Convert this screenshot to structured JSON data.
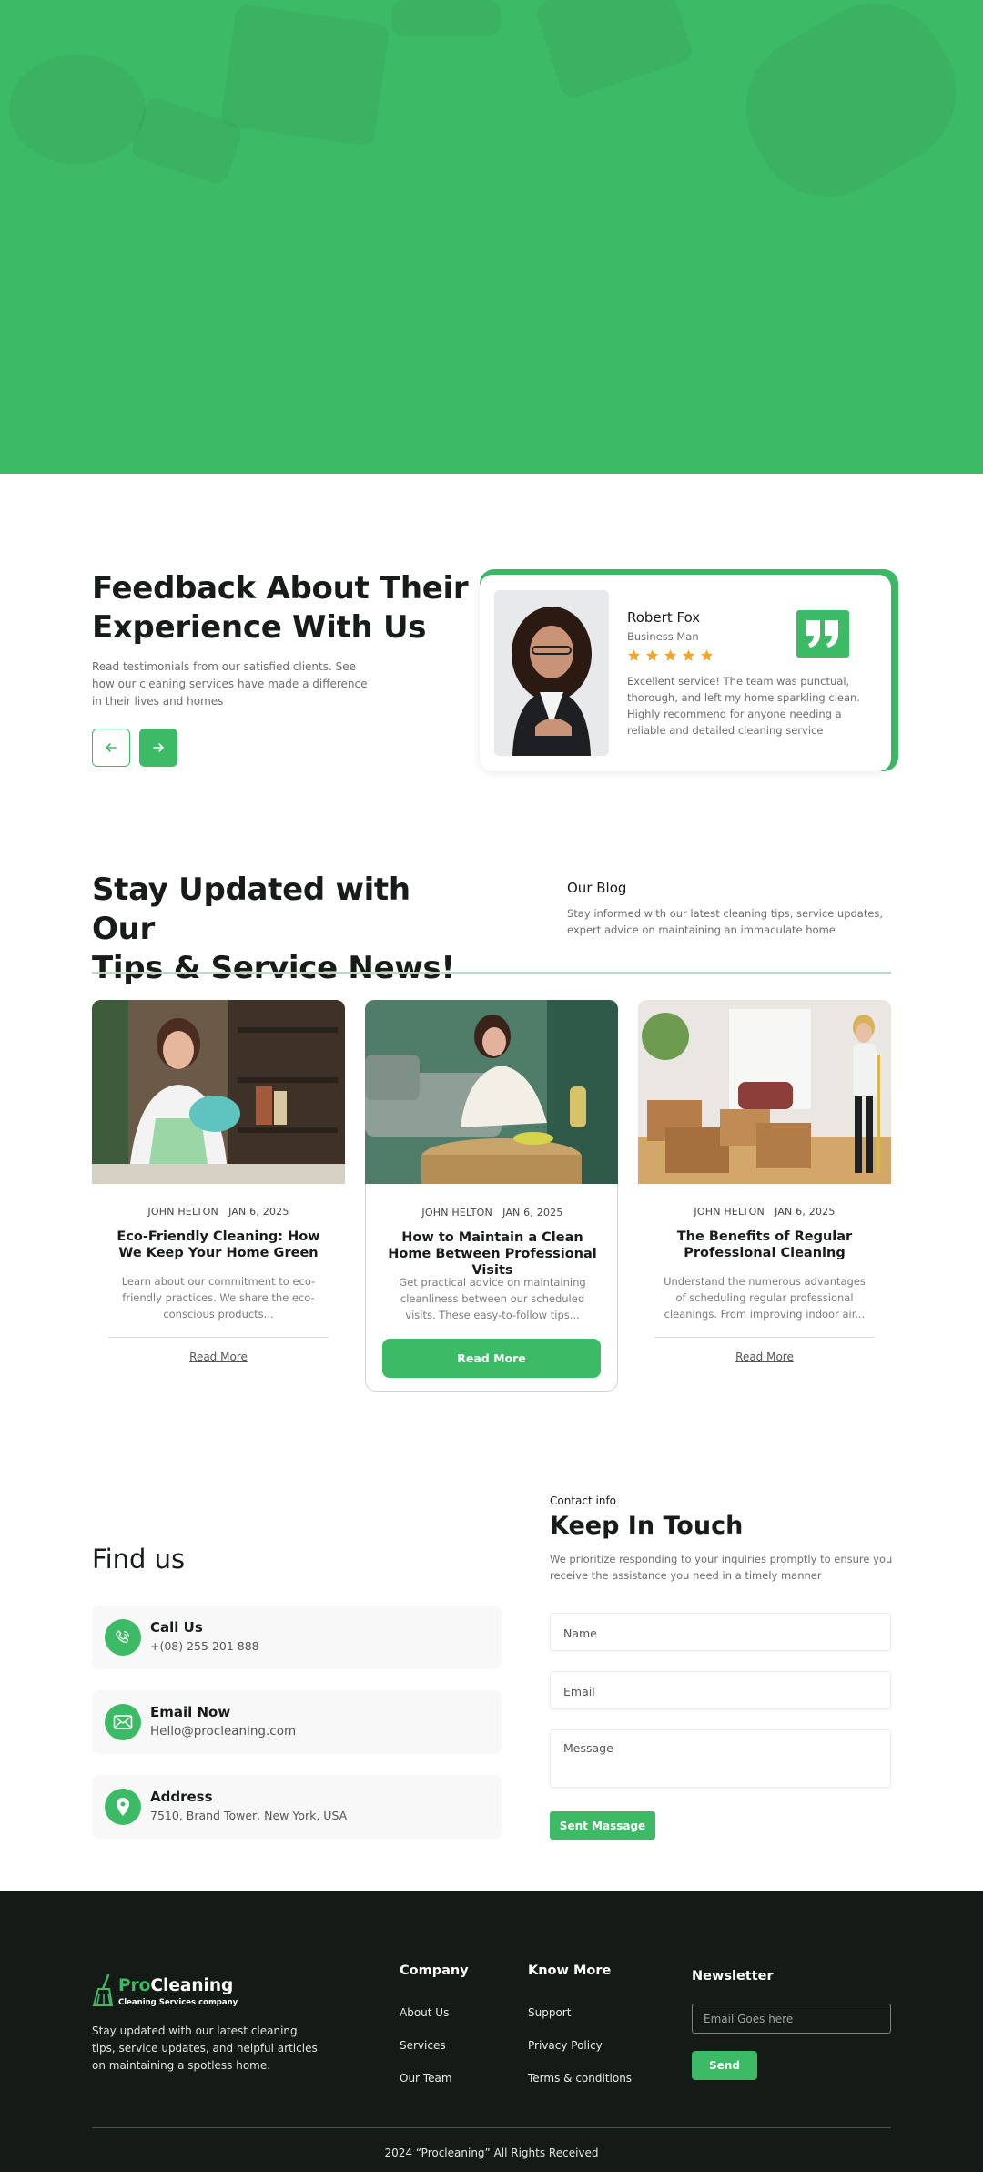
{
  "colors": {
    "accent": "#3dba66",
    "footer_bg": "#141b17",
    "star": "#f5a623"
  },
  "feedback": {
    "title_line1": "Feedback About Their",
    "title_line2": "Experience With Us",
    "description": "Read testimonials from our satisfied clients. See how our cleaning services have made a difference in their lives and homes",
    "prev_icon": "arrow-left-icon",
    "next_icon": "arrow-right-icon",
    "testimonial": {
      "name": "Robert Fox",
      "role": "Business Man",
      "rating": 5,
      "text": "Excellent service! The team was punctual, thorough, and left my home sparkling clean. Highly recommend for anyone needing a reliable and detailed cleaning service"
    }
  },
  "blog": {
    "title_line1": "Stay Updated with Our",
    "title_line2": "Tips & Service News!",
    "label": "Our Blog",
    "description": "Stay informed with our latest cleaning tips, service updates, expert advice on maintaining an immaculate home",
    "posts": [
      {
        "author": "JOHN HELTON",
        "date": "JAN 6, 2025",
        "title": "Eco-Friendly Cleaning: How We Keep Your Home Green",
        "excerpt": "Learn about our commitment to eco-friendly practices. We share the eco-conscious products...",
        "cta": "Read More"
      },
      {
        "author": "JOHN HELTON",
        "date": "JAN 6, 2025",
        "title": "How to Maintain a Clean Home Between Professional Visits",
        "excerpt": "Get practical advice on maintaining cleanliness between our scheduled visits. These easy-to-follow tips...",
        "cta": "Read More"
      },
      {
        "author": "JOHN HELTON",
        "date": "JAN 6, 2025",
        "title": "The Benefits of Regular Professional Cleaning",
        "excerpt": "Understand the numerous advantages of scheduling regular professional cleanings. From improving indoor air...",
        "cta": "Read More"
      }
    ]
  },
  "find": {
    "title": "Find us",
    "items": [
      {
        "title": "Call Us",
        "value": "+(08) 255 201 888",
        "icon": "phone-icon"
      },
      {
        "title": "Email Now",
        "value": "Hello@procleaning.com",
        "icon": "mail-icon"
      },
      {
        "title": "Address",
        "value": "7510, Brand Tower, New York, USA",
        "icon": "location-pin-icon"
      }
    ]
  },
  "contact": {
    "label": "Contact info",
    "title": "Keep In Touch",
    "description": "We prioritize responding to your inquiries promptly to ensure you receive the assistance you need in a timely manner",
    "name_placeholder": "Name",
    "email_placeholder": "Email",
    "message_placeholder": "Message",
    "submit": "Sent Massage"
  },
  "footer": {
    "brand_pro": "Pro",
    "brand_rest": "Cleaning",
    "brand_tag": "Cleaning Services company",
    "about": "Stay updated with our latest cleaning tips, service updates, and helpful articles on maintaining a spotless home.",
    "company": {
      "heading": "Company",
      "links": [
        "About Us",
        "Services",
        "Our Team"
      ]
    },
    "know": {
      "heading": "Know More",
      "links": [
        "Support",
        "Privacy Policy",
        "Terms & conditions"
      ]
    },
    "newsletter": {
      "heading": "Newsletter",
      "placeholder": "Email Goes here",
      "button": "Send"
    },
    "copyright": "2024 “Procleaning” All Rights Received"
  }
}
